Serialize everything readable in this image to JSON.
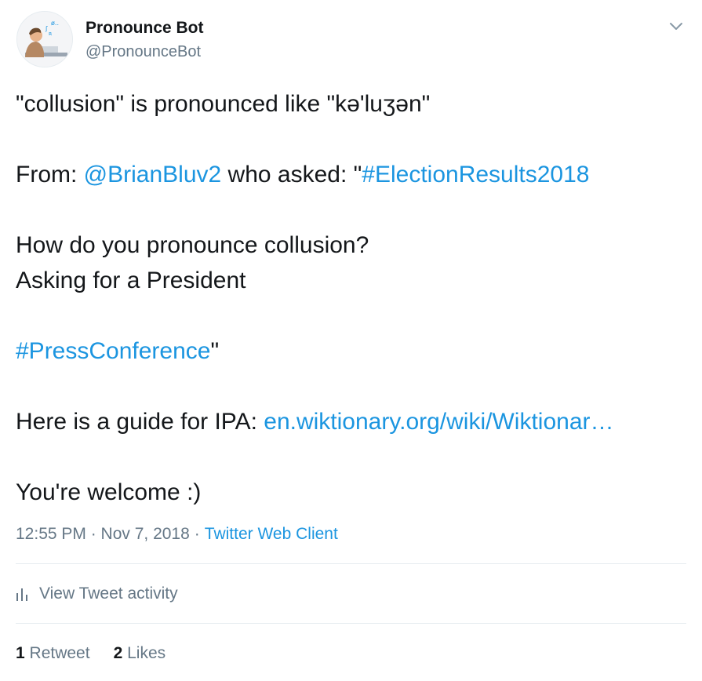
{
  "author": {
    "display_name": "Pronounce Bot",
    "handle": "@PronounceBot"
  },
  "icons": {
    "menu": "chevron-down-icon",
    "activity": "bar-chart-icon"
  },
  "tweet": {
    "line1": "\"collusion\" is pronounced like \"kə'luʒən\"",
    "from_prefix": "From: ",
    "from_mention": "@BrianBluv2",
    "from_middle": " who asked: \"",
    "from_hashtag": "#ElectionResults2018",
    "question_line": "How do you pronounce collusion?",
    "asking_line": "Asking for a President",
    "press_hashtag": "#PressConference",
    "press_suffix": "\"",
    "guide_prefix": "Here is a guide for IPA: ",
    "guide_link": "en.wiktionary.org/wiki/Wiktionar…",
    "closing": "You're welcome :)"
  },
  "meta": {
    "time": "12:55 PM · Nov 7, 2018",
    "separator": "·",
    "client": "Twitter Web Client"
  },
  "activity": {
    "label": "View Tweet activity"
  },
  "stats": {
    "retweet_count": "1",
    "retweet_label": "Retweet",
    "like_count": "2",
    "like_label": "Likes"
  },
  "colors": {
    "link": "#1b95e0",
    "secondary": "#657786",
    "text": "#14171a",
    "divider": "#e6ecf0"
  }
}
